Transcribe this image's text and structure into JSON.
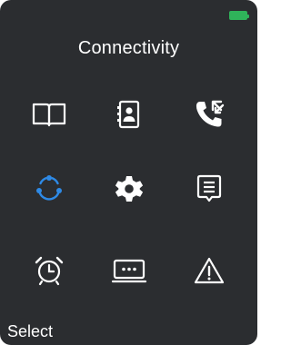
{
  "status_bar": {
    "battery_color": "#2fb35a"
  },
  "header": {
    "title": "Connectivity"
  },
  "menu": {
    "items": [
      {
        "icon": "book-icon",
        "selected": false
      },
      {
        "icon": "contacts-icon",
        "selected": false
      },
      {
        "icon": "call-log-icon",
        "selected": false
      },
      {
        "icon": "connectivity-icon",
        "selected": true
      },
      {
        "icon": "settings-icon",
        "selected": false
      },
      {
        "icon": "messages-icon",
        "selected": false
      },
      {
        "icon": "alarm-icon",
        "selected": false
      },
      {
        "icon": "keyboard-icon",
        "selected": false
      },
      {
        "icon": "warning-icon",
        "selected": false
      }
    ],
    "accent_color": "#2e8ae6",
    "icon_color": "#ffffff"
  },
  "softkeys": {
    "left": "Select"
  }
}
